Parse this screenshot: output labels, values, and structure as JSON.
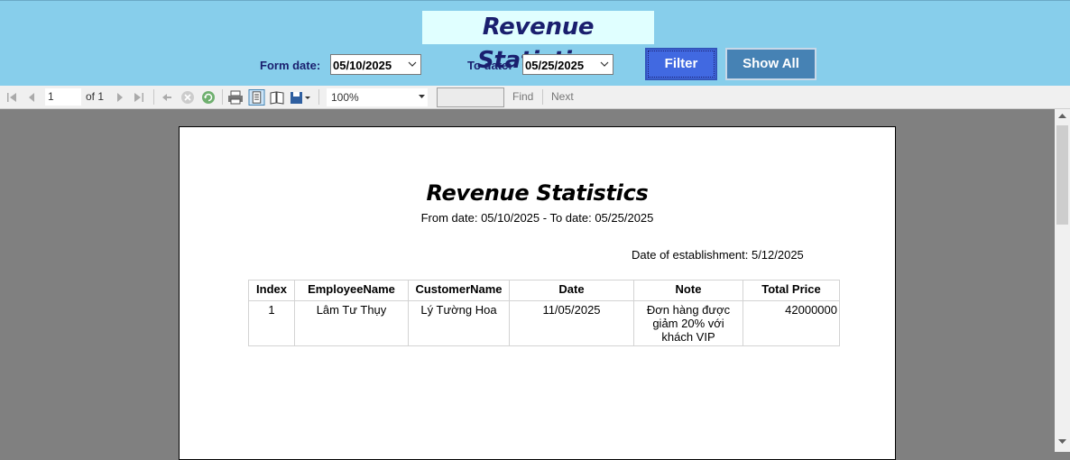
{
  "header": {
    "title": "Revenue Statistics",
    "from_label": "Form date:",
    "from_value": "05/10/2025",
    "to_label": "To date:",
    "to_value": "05/25/2025",
    "filter_label": "Filter",
    "show_all_label": "Show All"
  },
  "toolbar": {
    "page": "1",
    "of_label": "of 1",
    "zoom": "100%",
    "find_label": "Find",
    "next_label": "Next",
    "icons": [
      "first-page-icon",
      "prev-page-icon",
      "next-page-icon",
      "last-page-icon",
      "back-icon",
      "stop-icon",
      "refresh-icon",
      "print-icon",
      "print-layout-icon",
      "page-setup-icon",
      "export-icon"
    ]
  },
  "report": {
    "title": "Revenue Statistics",
    "date_range": "From date: 05/10/2025 - To date: 05/25/2025",
    "established": "Date of establishment: 5/12/2025",
    "columns": [
      "Index",
      "EmployeeName",
      "CustomerName",
      "Date",
      "Note",
      "Total Price"
    ],
    "rows": [
      {
        "index": "1",
        "employee": "Lâm Tư Thụy",
        "customer": "Lý Tường Hoa",
        "date": "11/05/2025",
        "note": "Đơn hàng được giảm 20% với khách VIP",
        "price": "42000000"
      }
    ]
  },
  "colors": {
    "header_bg": "#87ceeb",
    "title_bg": "#e0ffff",
    "title_text": "#1a1f6e",
    "filter_btn": "#4169e1",
    "show_all_btn": "#4682b4",
    "viewer_bg": "#808080"
  }
}
